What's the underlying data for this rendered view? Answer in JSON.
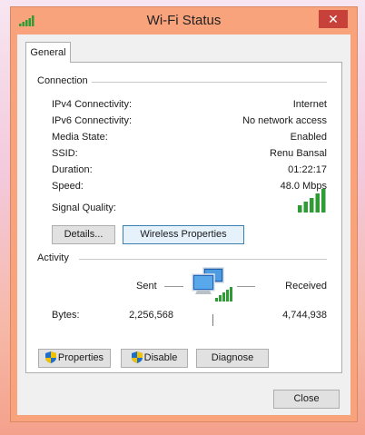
{
  "window": {
    "title": "Wi-Fi Status",
    "close_label": "✕"
  },
  "tabs": [
    {
      "label": "General"
    }
  ],
  "connection": {
    "group_label": "Connection",
    "rows": [
      {
        "label": "IPv4 Connectivity:",
        "value": "Internet"
      },
      {
        "label": "IPv6 Connectivity:",
        "value": "No network access"
      },
      {
        "label": "Media State:",
        "value": "Enabled"
      },
      {
        "label": "SSID:",
        "value": "Renu Bansal"
      },
      {
        "label": "Duration:",
        "value": "01:22:17"
      },
      {
        "label": "Speed:",
        "value": "48.0 Mbps"
      }
    ],
    "signal_label": "Signal Quality:",
    "signal_bars": 5,
    "details_button": "Details...",
    "wireless_button": "Wireless Properties"
  },
  "activity": {
    "group_label": "Activity",
    "sent_label": "Sent",
    "received_label": "Received",
    "bytes_label": "Bytes:",
    "bytes_sent": "2,256,568",
    "bytes_received": "4,744,938",
    "properties_button": "Properties",
    "disable_button": "Disable",
    "diagnose_button": "Diagnose"
  },
  "footer": {
    "close_button": "Close"
  },
  "colors": {
    "titlebar": "#f9a37c",
    "close": "#c7403a",
    "signal_green": "#2e9b34",
    "focus_blue": "#3c7fb1"
  },
  "icons": [
    "wifi-signal-icon",
    "network-computers-icon",
    "uac-shield-icon"
  ]
}
